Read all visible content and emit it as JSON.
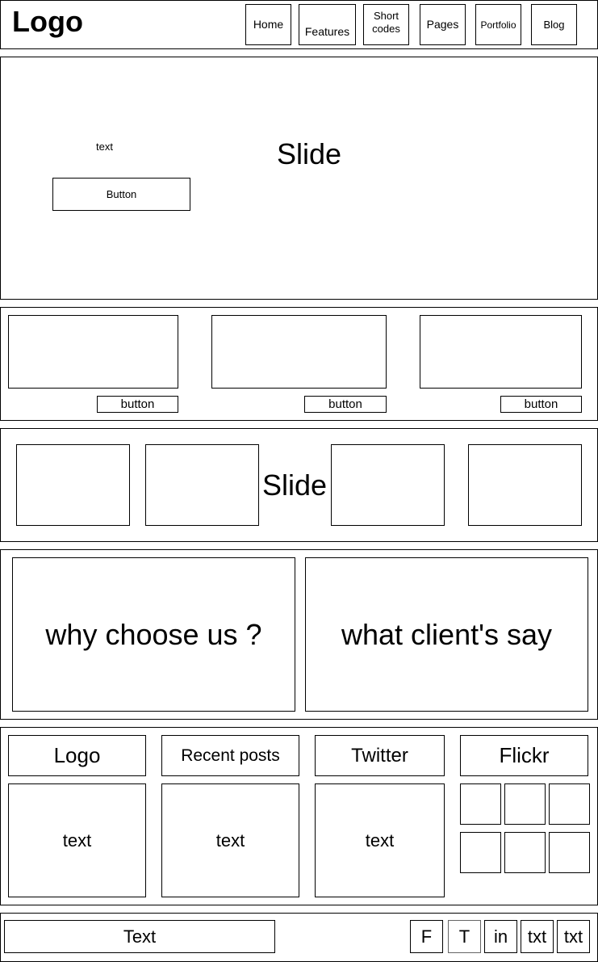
{
  "header": {
    "logo": "Logo",
    "nav": [
      {
        "label": "Home"
      },
      {
        "label": "Features"
      },
      {
        "label": "Short\ncodes"
      },
      {
        "label": "Pages"
      },
      {
        "label": "Portfolio"
      },
      {
        "label": "Blog"
      }
    ]
  },
  "hero": {
    "text": "text",
    "button": "Button",
    "slide_label": "Slide"
  },
  "features": {
    "buttons": [
      "button",
      "button",
      "button"
    ]
  },
  "carousel": {
    "slide_label": "Slide"
  },
  "info": {
    "left": "why choose us ?",
    "right": "what client's say"
  },
  "footer_widgets": {
    "headers": [
      "Logo",
      "Recent posts",
      "Twitter",
      "Flickr"
    ],
    "texts": [
      "text",
      "text",
      "text"
    ]
  },
  "bottom_bar": {
    "text": "Text",
    "social": [
      "F",
      "T",
      "in",
      "txt",
      "txt"
    ]
  }
}
